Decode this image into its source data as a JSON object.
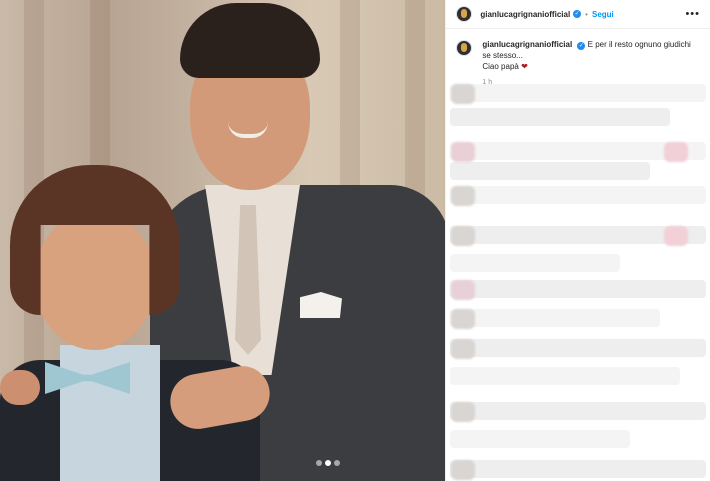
{
  "post": {
    "username": "gianlucagrignaniofficial",
    "follow_label": "Segui",
    "separator": "•",
    "more_label": "•••",
    "caption_line_1": "E per il resto ognuno giudichi se stesso...",
    "caption_line_2": "Ciao papà",
    "heart_icon": "❤",
    "timestamp": "1 h"
  },
  "colors": {
    "follow": "#0095f6",
    "verified": "#1f8cef",
    "heart": "#b31d1d"
  },
  "carousel": {
    "current_index": 2,
    "total": 3
  }
}
